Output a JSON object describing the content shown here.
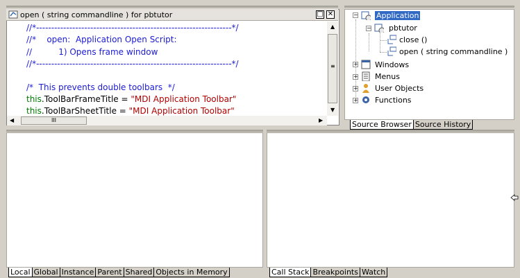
{
  "script": {
    "title": "open ( string commandline ) for pbtutor",
    "lines": [
      "//*-----------------------------------------------------------------*/",
      "//*    open:  Application Open Script:",
      "//          1) Opens frame window",
      "//*-----------------------------------------------------------------*/",
      "",
      "/*  This prevents double toolbars  */",
      "this.ToolBarFrameTitle = \"MDI Application Toolbar\"",
      "this.ToolBarSheetTitle = \"MDI Application Toolbar\""
    ],
    "line6_kw": "this",
    "line6_rest": ".ToolBarFrameTitle = ",
    "line6_str": "\"MDI Application Toolbar\"",
    "line7_kw": "this",
    "line7_rest": ".ToolBarSheetTitle = ",
    "line7_str": "\"MDI Application Toolbar\"",
    "hscroll_thumb": "III"
  },
  "tree": {
    "root": "Application",
    "child": "pbtutor",
    "events": [
      "close ()",
      "open ( string commandline )"
    ],
    "sections": [
      "Windows",
      "Menus",
      "User Objects",
      "Functions"
    ]
  },
  "source_tabs": [
    "Source Browser",
    "Source History"
  ],
  "variable_tabs": [
    "Local",
    "Global",
    "Instance",
    "Parent",
    "Shared",
    "Objects in Memory"
  ],
  "debug_tabs": [
    "Call Stack",
    "Breakpoints",
    "Watch"
  ]
}
